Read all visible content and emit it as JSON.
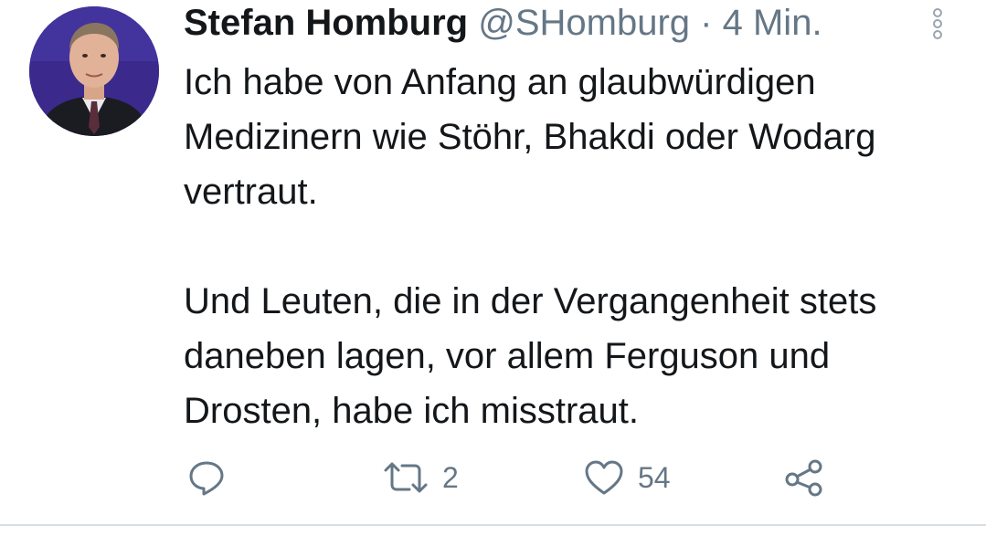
{
  "tweet": {
    "author_name": "Stefan Homburg",
    "handle": "@SHomburg",
    "separator": "·",
    "time": "4 Min.",
    "paragraphs": [
      "Ich habe von Anfang an glaubwürdigen Medizinern wie Stöhr, Bhakdi oder Wodarg vertraut.",
      "Und Leuten, die in der Vergangenheit stets daneben lagen, vor allem Ferguson und Drosten, habe ich misstraut."
    ],
    "actions": {
      "reply_icon": "reply-icon",
      "retweet_icon": "retweet-icon",
      "retweet_count": "2",
      "like_icon": "heart-icon",
      "like_count": "54",
      "share_icon": "share-icon"
    },
    "more_icon": "more-options-icon",
    "colors": {
      "text": "#14171a",
      "secondary": "#657786",
      "avatar_bg": "#3b2a8c"
    }
  }
}
